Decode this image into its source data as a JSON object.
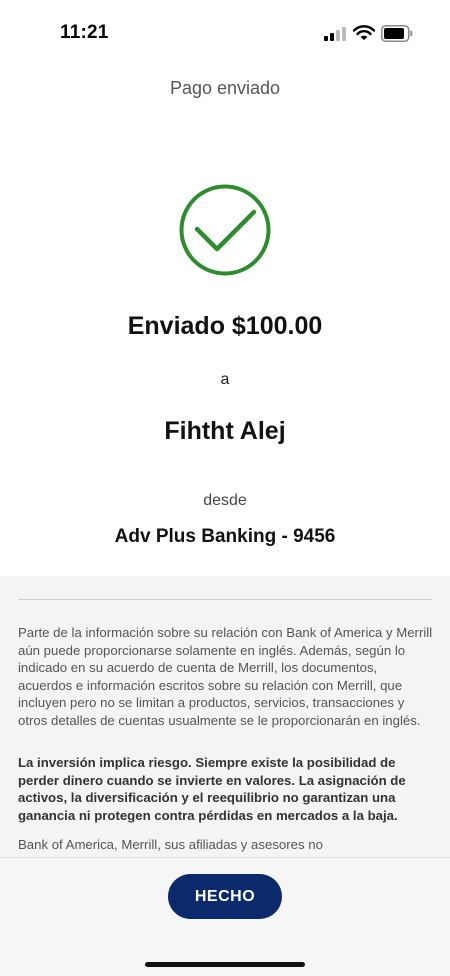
{
  "status_bar": {
    "time": "11:21"
  },
  "header": {
    "title": "Pago enviado"
  },
  "confirmation": {
    "amount_text": "Enviado $100.00",
    "to_label": "a",
    "recipient": "Fihtht Alej",
    "from_label": "desde",
    "account": "Adv Plus Banking - 9456"
  },
  "disclosure": {
    "paragraph1": "Parte de la información sobre su relación con Bank of America y Merrill aún puede proporcionarse solamente en inglés. Además, según lo indicado en su acuerdo de cuenta de Merrill, los documentos, acuerdos e información escritos sobre su relación con Merrill, que incluyen pero no se limitan a productos, servicios, transacciones y otros detalles de cuentas usualmente se le proporcionarán en inglés.",
    "paragraph2": "La inversión implica riesgo. Siempre existe la posibilidad de perder dinero cuando se invierte en valores. La asignación de activos, la diversificación y el reequilibrio no garantizan una ganancia ni protegen contra pérdidas en mercados a la baja.",
    "paragraph3": "Bank of America, Merrill, sus afiliadas y asesores no"
  },
  "actions": {
    "done_label": "HECHO"
  },
  "colors": {
    "success": "#2e8b2e",
    "primary": "#0a2a6b"
  },
  "icons": {
    "status": [
      "signal-icon",
      "wifi-icon",
      "battery-icon"
    ],
    "confirmation": "checkmark-circle-icon"
  }
}
